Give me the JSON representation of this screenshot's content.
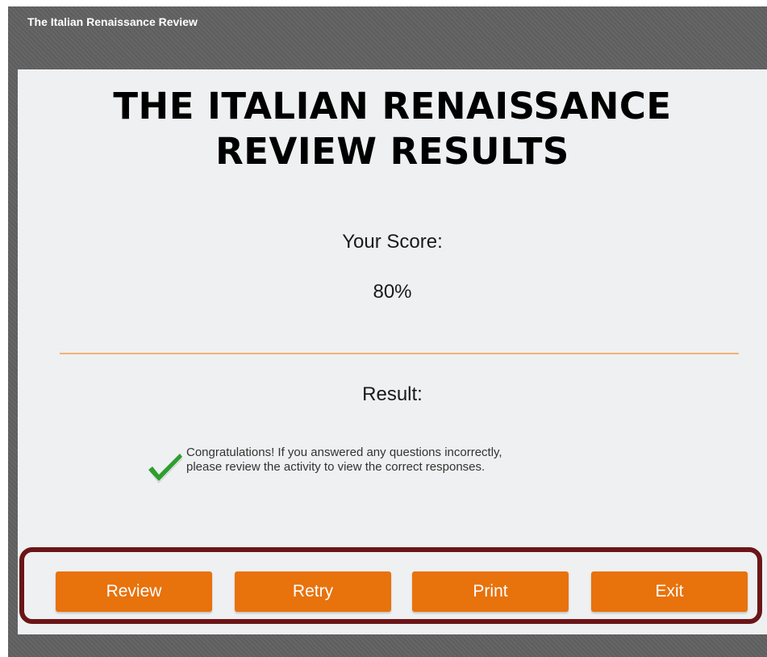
{
  "window": {
    "title": "The Italian Renaissance Review"
  },
  "results": {
    "heading_line1": "THE ITALIAN RENAISSANCE",
    "heading_line2": "REVIEW RESULTS",
    "score_label": "Your Score:",
    "score_value": "80%",
    "result_label": "Result:",
    "result_icon": "checkmark-icon",
    "message_line1": "Congratulations! If you answered any questions incorrectly,",
    "message_line2": "please review the activity to view the correct responses."
  },
  "buttons": {
    "review": "Review",
    "retry": "Retry",
    "print": "Print",
    "exit": "Exit"
  },
  "colors": {
    "accent_button": "#e8720c",
    "highlight_frame": "#6b1518",
    "divider": "#f0b27a",
    "check": "#2e9e2e"
  }
}
